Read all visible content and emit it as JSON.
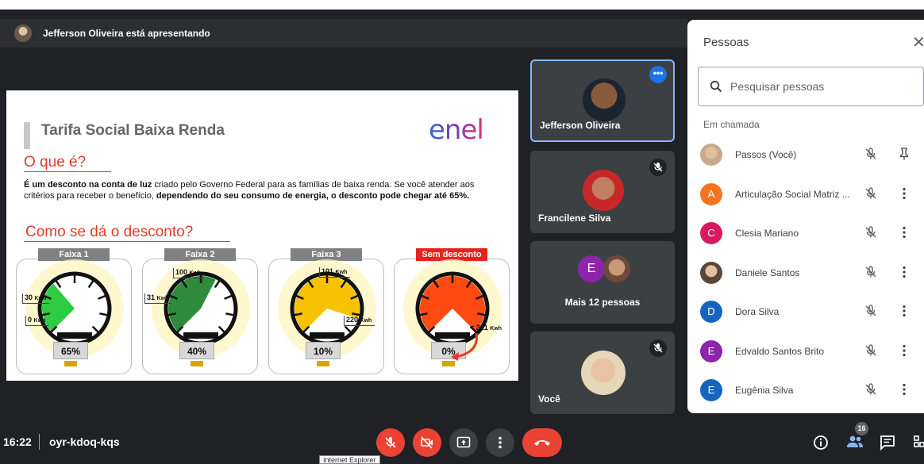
{
  "presenter": {
    "text": "Jefferson Oliveira está apresentando"
  },
  "slide": {
    "title": "Tarifa Social Baixa Renda",
    "logo": "enel",
    "question1": "O que é?",
    "para_bold1": "É um desconto na conta de luz",
    "para_text1": " criado pelo Governo Federal para as famílias de baixa renda. Se você atender aos critérios para receber o benefício, ",
    "para_bold2": "dependendo do seu consumo de energia, o desconto pode chegar até 65%.",
    "question2": "Como se dá o desconto?",
    "gauges": [
      {
        "tag": "Faixa 1",
        "pct": "65%",
        "level": 0.65,
        "color": "#2ecc40"
      },
      {
        "tag": "Faixa 2",
        "pct": "40%",
        "level": 0.4,
        "color": "#2e8b3a"
      },
      {
        "tag": "Faixa 3",
        "pct": "10%",
        "level": 0.1,
        "color": "#f6c200"
      },
      {
        "tag": "Sem desconto",
        "pct": "0%",
        "level": 0.0,
        "color": "#ff4a12"
      }
    ],
    "labels": {
      "g1a": "30",
      "g1b": "0",
      "g2a": "100",
      "g2b": "31",
      "g3a": "101",
      "g3b": "220",
      "g4a": "< 221",
      "unit": "Kwh"
    }
  },
  "tiles": {
    "t1": {
      "name": "Jefferson Oliveira",
      "dots": "•••"
    },
    "t2": {
      "name": "Francilene Silva"
    },
    "t3": {
      "letter": "E",
      "more": "Mais 12 pessoas"
    },
    "t4": {
      "name": "Você"
    }
  },
  "panel": {
    "title": "Pessoas",
    "close": "✕",
    "search_placeholder": "Pesquisar pessoas",
    "section": "Em chamada",
    "people": [
      {
        "name": "Passos (Você)",
        "avatar": "",
        "color": "#c9a98a"
      },
      {
        "name": "Articulação Social Matriz ...",
        "avatar": "A",
        "color": "#f4741f"
      },
      {
        "name": "Clesia Mariano",
        "avatar": "C",
        "color": "#d81b60"
      },
      {
        "name": "Daniele Santos",
        "avatar": "",
        "color": "#5a4636"
      },
      {
        "name": "Dora Silva",
        "avatar": "D",
        "color": "#1565c0"
      },
      {
        "name": "Edvaldo Santos Brito",
        "avatar": "E",
        "color": "#8e24aa"
      },
      {
        "name": "Eugênia Silva",
        "avatar": "E",
        "color": "#1565c0"
      }
    ]
  },
  "bottom": {
    "time": "16:22",
    "code": "oyr-kdoq-kqs",
    "tooltip": "Internet Explorer",
    "badge": "16"
  }
}
